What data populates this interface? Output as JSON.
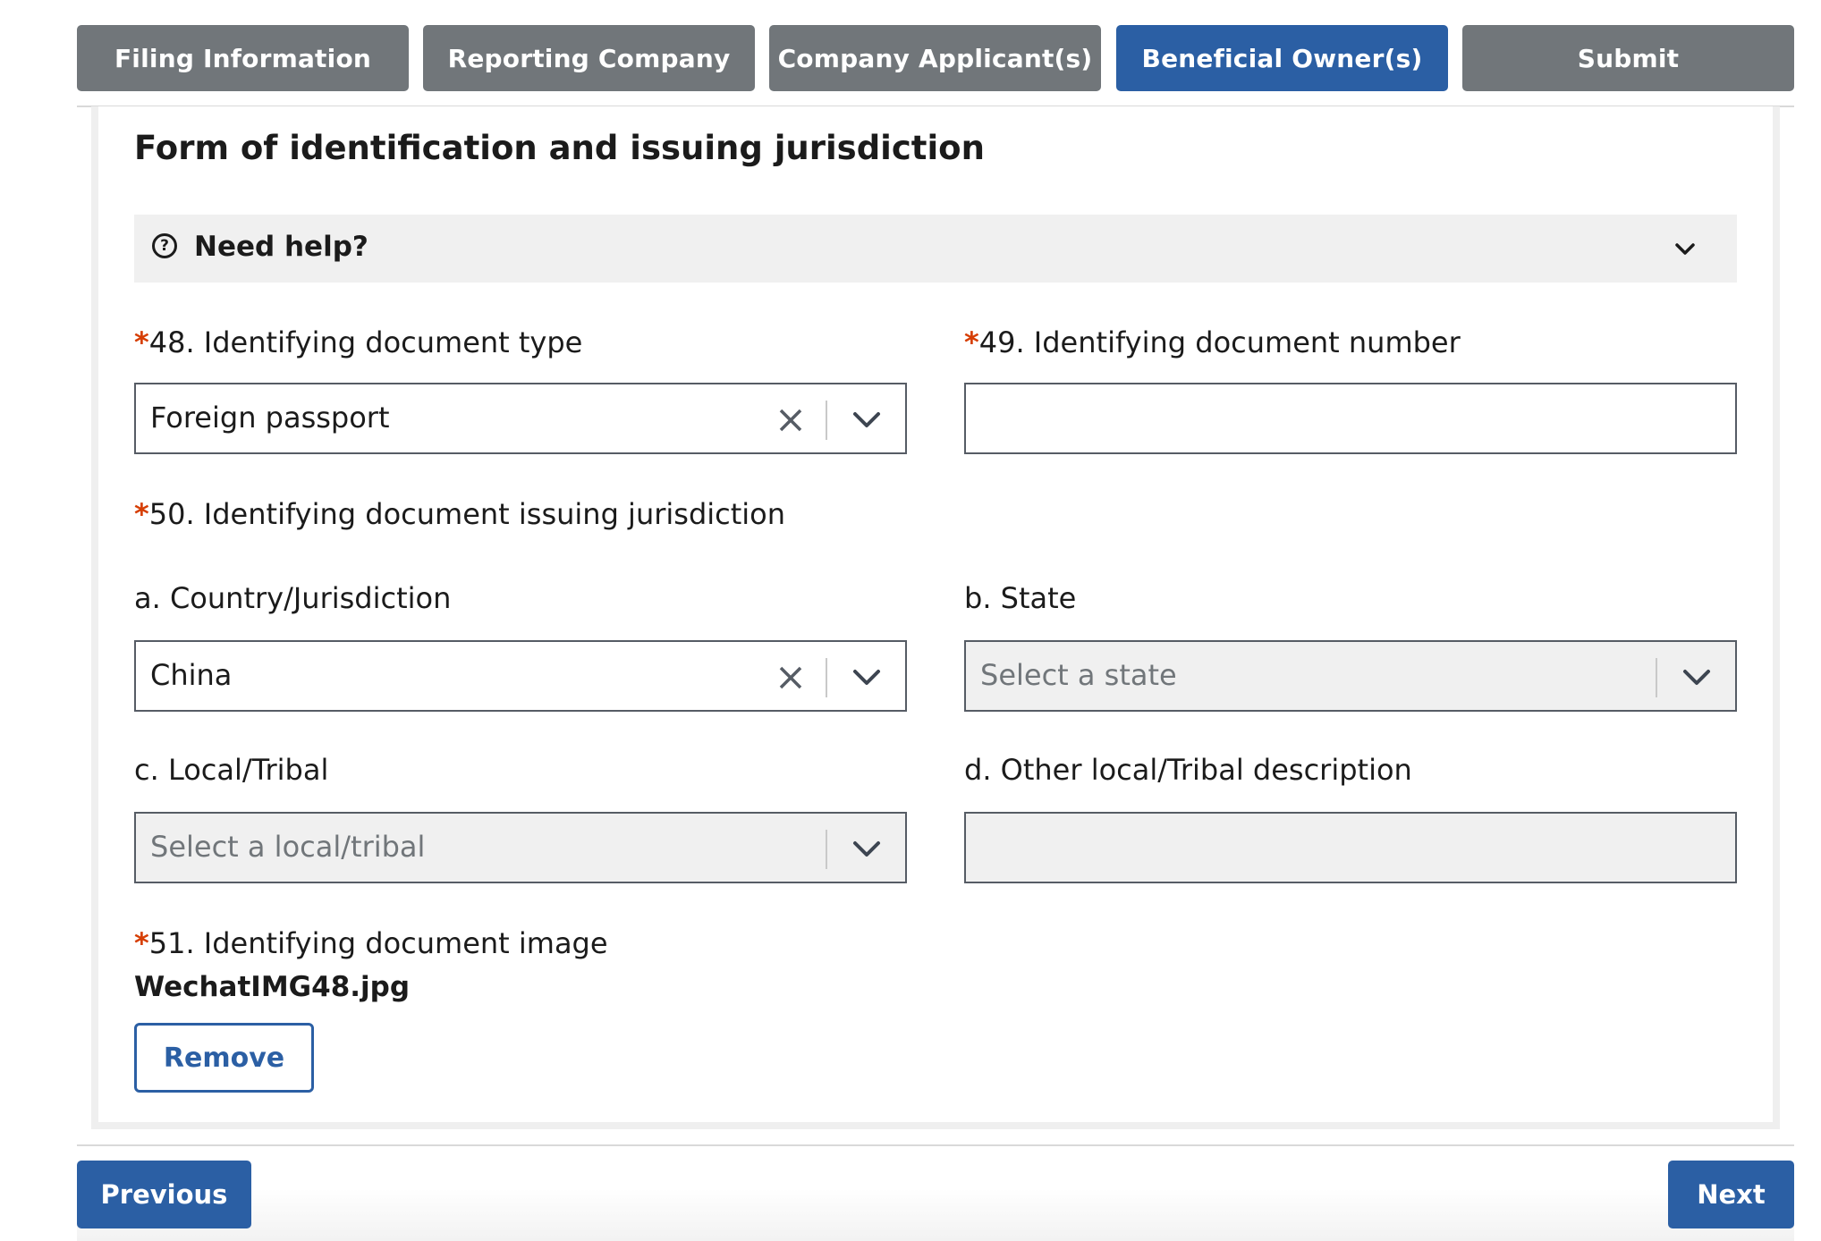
{
  "tabs": [
    {
      "label": "Filing Information",
      "active": false
    },
    {
      "label": "Reporting Company",
      "active": false
    },
    {
      "label": "Company Applicant(s)",
      "active": false
    },
    {
      "label": "Beneficial Owner(s)",
      "active": true
    },
    {
      "label": "Submit",
      "active": false
    }
  ],
  "section": {
    "title": "Form of identification and issuing jurisdiction",
    "help_label": "Need help?",
    "help_icon": "question-circle-icon"
  },
  "fields": {
    "required_marker": "*",
    "doc_type": {
      "label": "48. Identifying document type",
      "value": "Foreign passport"
    },
    "doc_number": {
      "label": "49. Identifying document number",
      "value": ""
    },
    "jurisdiction_heading": "50. Identifying document issuing jurisdiction",
    "country": {
      "label": "a. Country/Jurisdiction",
      "value": "China"
    },
    "state": {
      "label": "b. State",
      "placeholder": "Select a state"
    },
    "local_tribal": {
      "label": "c. Local/Tribal",
      "placeholder": "Select a local/tribal"
    },
    "other_local": {
      "label": "d. Other local/Tribal description",
      "value": ""
    },
    "doc_image": {
      "label": "51. Identifying document image",
      "filename": "WechatIMG48.jpg",
      "remove_label": "Remove"
    }
  },
  "footer": {
    "previous_label": "Previous",
    "next_label": "Next"
  },
  "colors": {
    "primary": "#2b5fa4",
    "tab_inactive": "#71767a",
    "required": "#d63e04",
    "disabled_bg": "#f0f0f0"
  }
}
